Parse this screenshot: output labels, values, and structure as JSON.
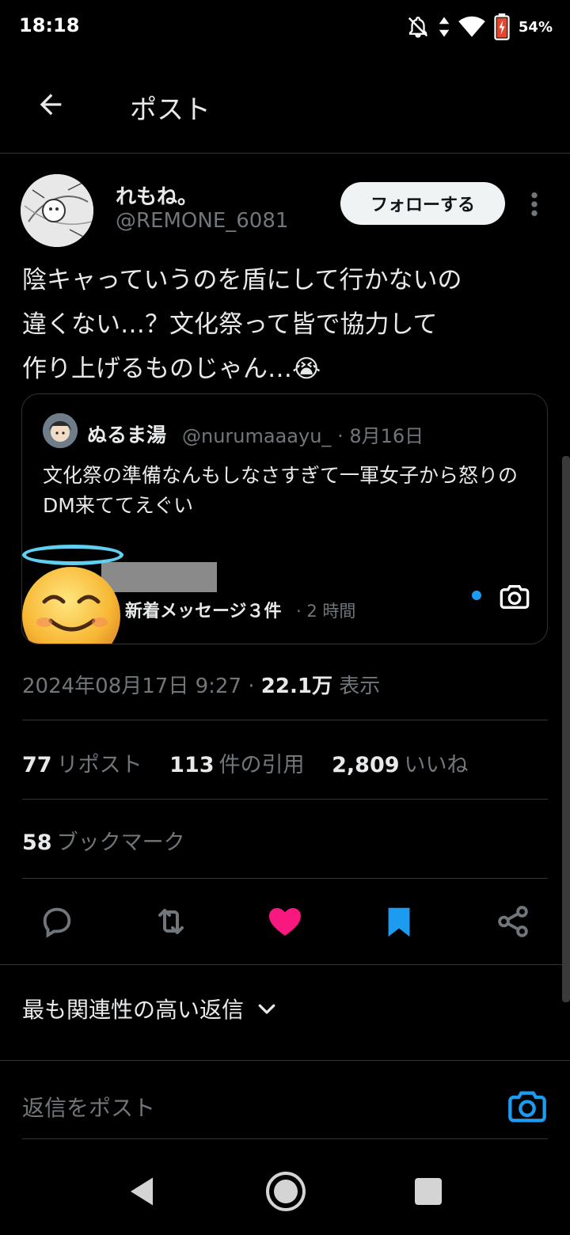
{
  "status_bar": {
    "time": "18:18",
    "battery": "54%",
    "icons": [
      "notifications-off-icon",
      "data-arrows-icon",
      "wifi-icon",
      "battery-icon"
    ]
  },
  "header": {
    "title": "ポスト",
    "back_icon": "arrow-left-icon"
  },
  "post": {
    "author": {
      "name": "れもね。",
      "handle": "@REMONE_6081"
    },
    "follow_label": "フォローする",
    "text_lines": [
      "陰キャっていうのを盾にして行かないの",
      "違くない…？文化祭って皆で協力して",
      "作り上げるものじゃん…😭"
    ],
    "quote": {
      "name": "ぬるま湯",
      "handle": "@nurumaaayu_",
      "date": "· 8月16日",
      "text": "文化祭の準備なんもしなさすぎて一軍女子から怒りのDM来ててえぐい",
      "message_label": "新着メッセージ３件",
      "message_time": "· 2 時間"
    },
    "timestamp": "2024年08月17日 9:27 ·",
    "views_count": "22.1万",
    "views_label": "表示",
    "stats": {
      "reposts_count": "77",
      "reposts_label": "リポスト",
      "quotes_count": "113",
      "quotes_label": "件の引用",
      "likes_count": "2,809",
      "likes_label": "いいね",
      "bookmarks_count": "58",
      "bookmarks_label": "ブックマーク"
    },
    "actions": [
      "reply-icon",
      "repost-icon",
      "like-icon",
      "bookmark-icon",
      "share-icon"
    ]
  },
  "replies": {
    "sort_label": "最も関連性の高い返信",
    "input_placeholder": "返信をポスト"
  },
  "colors": {
    "background": "#000000",
    "text": "#e7e9ea",
    "secondary": "#71767b",
    "accent": "#1d9bf0",
    "like": "#f91880"
  }
}
